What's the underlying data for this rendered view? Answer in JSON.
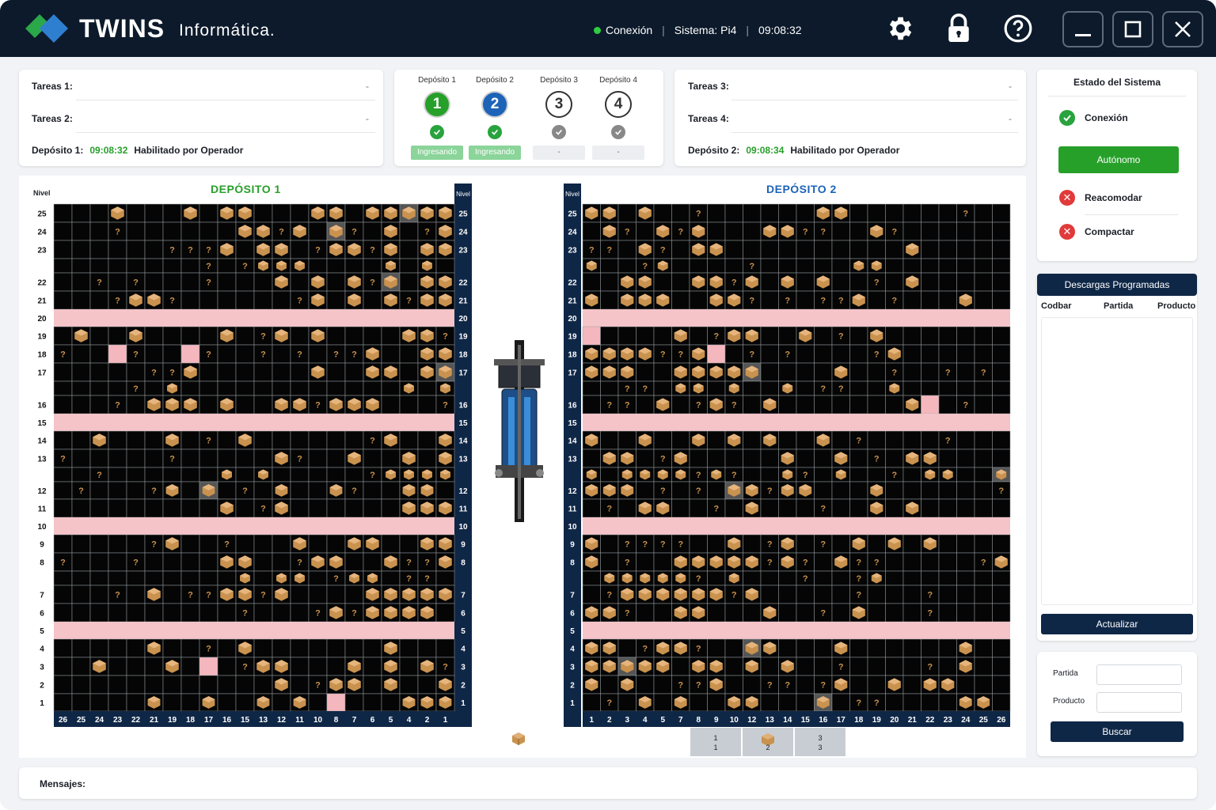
{
  "titlebar": {
    "brand": "TWINS",
    "brand_sub": "Informática.",
    "connection": "Conexión",
    "system": "Sistema: Pi4",
    "clock": "09:08:32"
  },
  "colors": {
    "navy": "#0f2747",
    "green": "#27a02a",
    "aisle": "#f4c4c8",
    "cell": "#050505",
    "box": "#c9924e",
    "titlebar": "#0c1a2b"
  },
  "tasks_left": {
    "t1": "Tareas 1:",
    "t2": "Tareas 2:",
    "dash": "-",
    "dep_label": "Depósito 1:",
    "dep_time": "09:08:32",
    "dep_status": "Habilitado por Operador"
  },
  "tasks_right": {
    "t3": "Tareas 3:",
    "t4": "Tareas 4:",
    "dash": "-",
    "dep_label": "Depósito 2:",
    "dep_time": "09:08:34",
    "dep_status": "Habilitado por Operador"
  },
  "depots": [
    {
      "label": "Depósito 1",
      "num": "1",
      "state": "Ingresando",
      "active": true
    },
    {
      "label": "Depósito 2",
      "num": "2",
      "state": "Ingresando",
      "active": true
    },
    {
      "label": "Depósito 3",
      "num": "3",
      "state": "-",
      "active": false
    },
    {
      "label": "Depósito 4",
      "num": "4",
      "state": "-",
      "active": false
    }
  ],
  "grid1": {
    "title": "DEPÓSITO 1",
    "level_header": "Nivel",
    "columns": [
      "26",
      "25",
      "24",
      "23",
      "22",
      "21",
      "19",
      "18",
      "17",
      "16",
      "15",
      "13",
      "12",
      "11",
      "10",
      "8",
      "7",
      "6",
      "5",
      "4",
      "2",
      "1"
    ]
  },
  "grid2": {
    "title": "DEPÓSITO 2",
    "level_header": "Nivel",
    "columns": [
      "1",
      "2",
      "3",
      "4",
      "5",
      "7",
      "8",
      "9",
      "10",
      "12",
      "13",
      "14",
      "15",
      "16",
      "17",
      "18",
      "19",
      "20",
      "21",
      "22",
      "23",
      "24",
      "25",
      "26"
    ]
  },
  "levels": [
    "25",
    "24",
    "23",
    "",
    "22",
    "21",
    "20",
    "19",
    "18",
    "17",
    "",
    "16",
    "15",
    "14",
    "13",
    "",
    "12",
    "11",
    "10",
    "9",
    "8",
    "",
    "7",
    "6",
    "5",
    "4",
    "3",
    "2",
    "1"
  ],
  "aisle_levels": [
    "20",
    "15",
    "10",
    "5"
  ],
  "selector": {
    "items": [
      {
        "top": "1",
        "bottom": "1"
      },
      {
        "top": "",
        "bottom": "2"
      },
      {
        "top": "3",
        "bottom": "3"
      }
    ]
  },
  "system": {
    "title": "Estado del Sistema",
    "connection": "Conexión",
    "mode": "Autónomo",
    "reaccomodate": "Reacomodar",
    "compact": "Compactar"
  },
  "downloads": {
    "title": "Descargas Programadas",
    "cols": [
      "Codbar",
      "Partida",
      "Producto"
    ],
    "refresh": "Actualizar"
  },
  "search": {
    "partida": "Partida",
    "producto": "Producto",
    "button": "Buscar"
  },
  "messages": {
    "label": "Mensajes:"
  }
}
